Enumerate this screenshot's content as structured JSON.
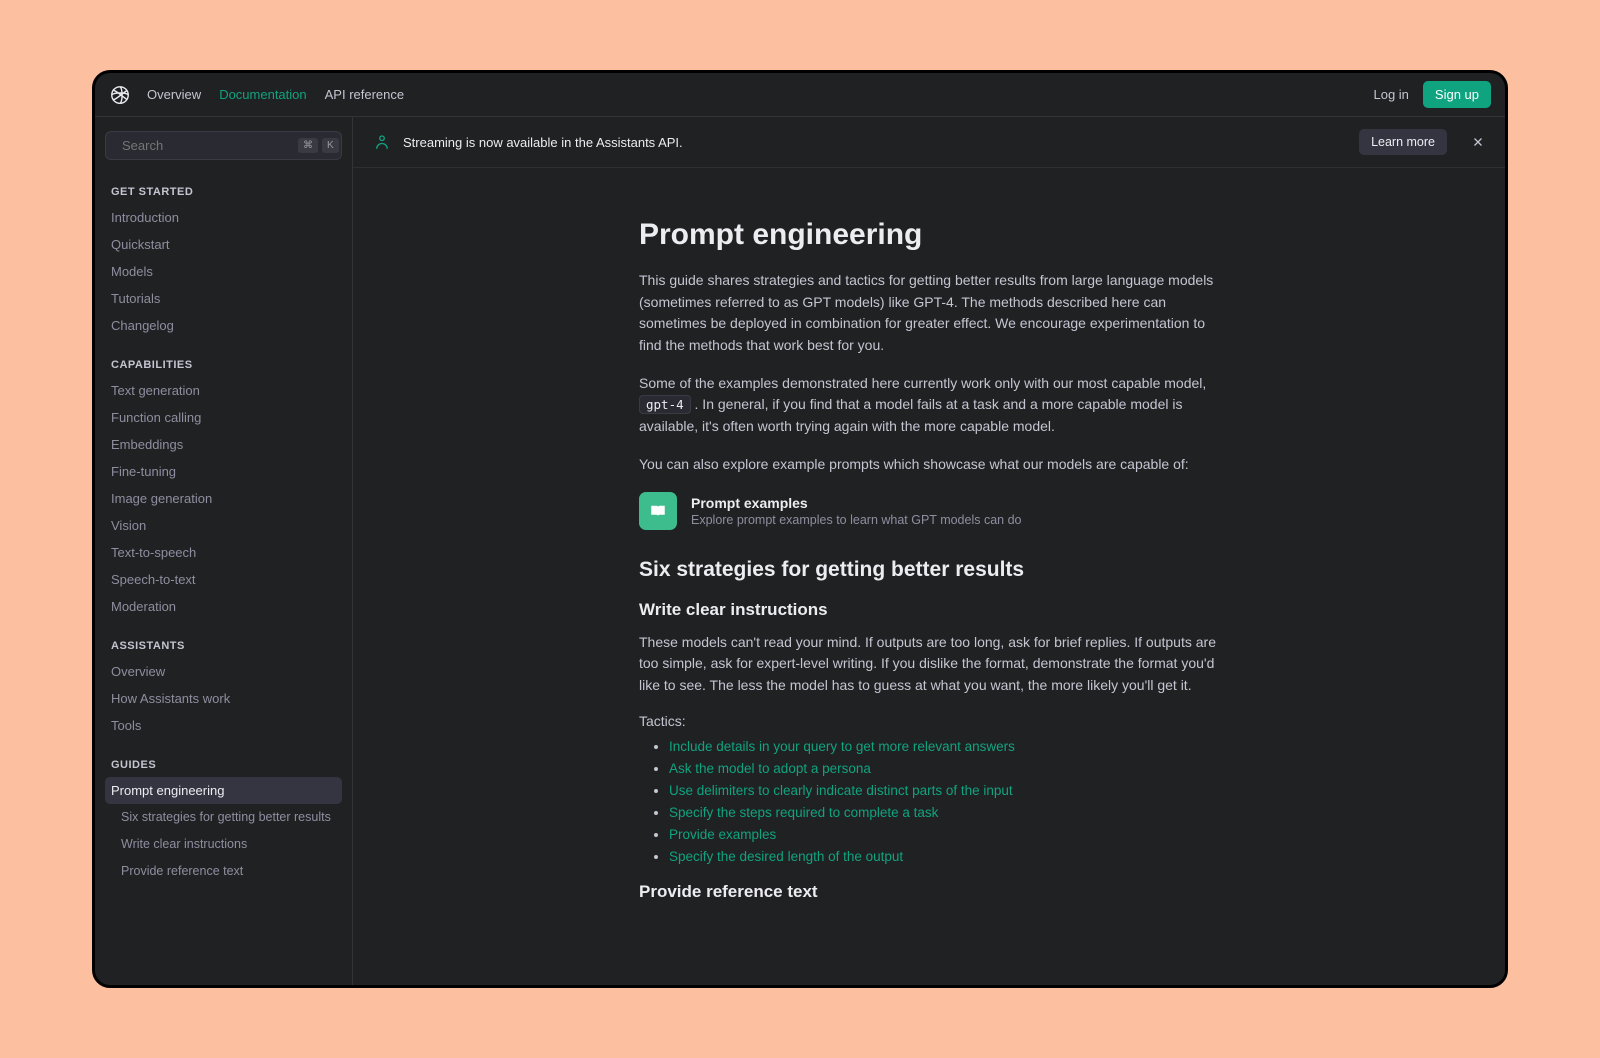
{
  "topnav": {
    "items": [
      {
        "label": "Overview",
        "active": false
      },
      {
        "label": "Documentation",
        "active": true
      },
      {
        "label": "API reference",
        "active": false
      }
    ],
    "login": "Log in",
    "signup": "Sign up"
  },
  "search": {
    "placeholder": "Search",
    "kbd1": "⌘",
    "kbd2": "K"
  },
  "sidebar": {
    "sections": [
      {
        "title": "GET STARTED",
        "items": [
          {
            "label": "Introduction"
          },
          {
            "label": "Quickstart"
          },
          {
            "label": "Models"
          },
          {
            "label": "Tutorials"
          },
          {
            "label": "Changelog"
          }
        ]
      },
      {
        "title": "CAPABILITIES",
        "items": [
          {
            "label": "Text generation"
          },
          {
            "label": "Function calling"
          },
          {
            "label": "Embeddings"
          },
          {
            "label": "Fine-tuning"
          },
          {
            "label": "Image generation"
          },
          {
            "label": "Vision"
          },
          {
            "label": "Text-to-speech"
          },
          {
            "label": "Speech-to-text"
          },
          {
            "label": "Moderation"
          }
        ]
      },
      {
        "title": "ASSISTANTS",
        "items": [
          {
            "label": "Overview"
          },
          {
            "label": "How Assistants work"
          },
          {
            "label": "Tools"
          }
        ]
      },
      {
        "title": "GUIDES",
        "items": [
          {
            "label": "Prompt engineering",
            "active": true
          }
        ],
        "subitems": [
          {
            "label": "Six strategies for getting better results"
          },
          {
            "label": "Write clear instructions"
          },
          {
            "label": "Provide reference text"
          }
        ]
      }
    ]
  },
  "banner": {
    "text": "Streaming is now available in the Assistants API.",
    "cta": "Learn more"
  },
  "page": {
    "title": "Prompt engineering",
    "intro1": "This guide shares strategies and tactics for getting better results from large language models (sometimes referred to as GPT models) like GPT-4. The methods described here can sometimes be deployed in combination for greater effect. We encourage experimentation to find the methods that work best for you.",
    "intro2_a": "Some of the examples demonstrated here currently work only with our most capable model, ",
    "intro2_code": "gpt-4",
    "intro2_b": " . In general, if you find that a model fails at a task and a more capable model is available, it's often worth trying again with the more capable model.",
    "intro3": "You can also explore example prompts which showcase what our models are capable of:",
    "card": {
      "title": "Prompt examples",
      "subtitle": "Explore prompt examples to learn what GPT models can do"
    },
    "h2": "Six strategies for getting better results",
    "strat1": {
      "title": "Write clear instructions",
      "body": "These models can't read your mind. If outputs are too long, ask for brief replies. If outputs are too simple, ask for expert-level writing. If you dislike the format, demonstrate the format you'd like to see. The less the model has to guess at what you want, the more likely you'll get it.",
      "tactics_label": "Tactics:",
      "tactics": [
        "Include details in your query to get more relevant answers",
        "Ask the model to adopt a persona",
        "Use delimiters to clearly indicate distinct parts of the input",
        "Specify the steps required to complete a task",
        "Provide examples",
        "Specify the desired length of the output"
      ]
    },
    "strat2": {
      "title": "Provide reference text"
    }
  }
}
